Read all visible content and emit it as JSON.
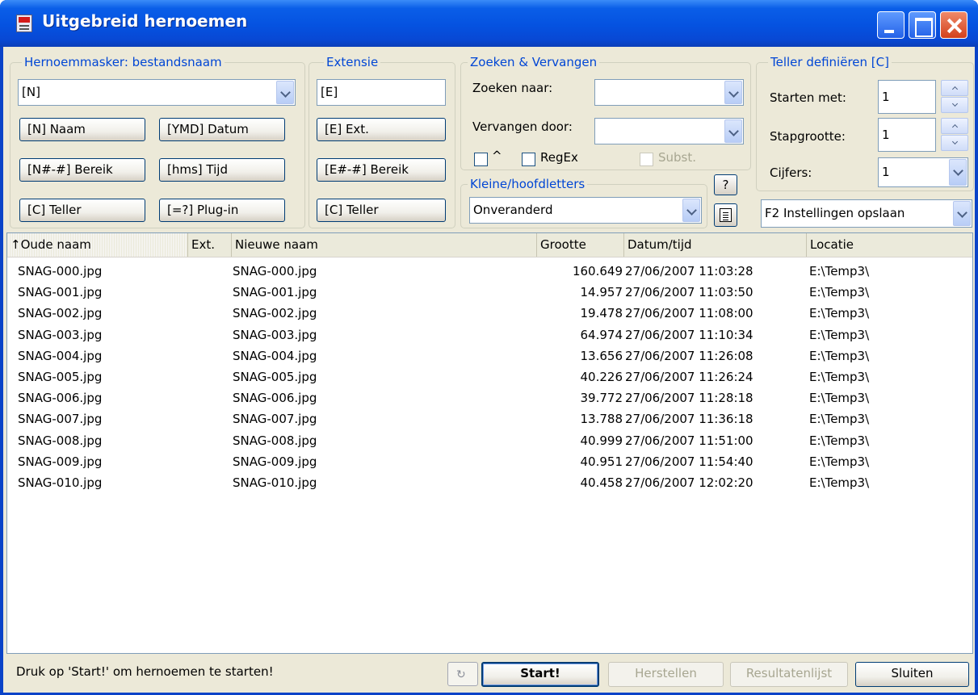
{
  "window": {
    "title": "Uitgebreid hernoemen"
  },
  "mask": {
    "label": "Hernoemmasker: bestandsnaam",
    "value": "[N]",
    "buttons": [
      "[N]  Naam",
      "[YMD]  Datum",
      "[N#-#] Bereik",
      "[hms]  Tijd",
      "[C]  Teller",
      "[=?]  Plug-in"
    ]
  },
  "ext": {
    "label": "Extensie",
    "value": "[E]",
    "buttons": [
      "[E]  Ext.",
      "[E#-#] Bereik",
      "[C]  Teller"
    ]
  },
  "search": {
    "label": "Zoeken & Vervangen",
    "find_label": "Zoeken naar:",
    "find_value": "",
    "replace_label": "Vervangen door:",
    "replace_value": "",
    "caret_label": "^",
    "regex_label": "RegEx",
    "subst_label": "Subst."
  },
  "case": {
    "label": "Kleine/hoofdletters",
    "value": "Onveranderd",
    "help_label": "?"
  },
  "counter": {
    "label": "Teller definiëren [C]",
    "start_label": "Starten met:",
    "start_value": "1",
    "step_label": "Stapgrootte:",
    "step_value": "1",
    "digits_label": "Cijfers:",
    "digits_value": "1"
  },
  "settings": {
    "value": "F2 Instellingen opslaan"
  },
  "list": {
    "columns": {
      "old": "Oude naam",
      "ext": "Ext.",
      "new": "Nieuwe naam",
      "size": "Grootte",
      "date": "Datum/tijd",
      "loc": "Locatie"
    },
    "sort_arrow": "↑",
    "rows": [
      {
        "old": "SNAG-000.jpg",
        "new": "SNAG-000.jpg",
        "size": "160.649",
        "date": "27/06/2007 11:03:28",
        "loc": "E:\\Temp3\\"
      },
      {
        "old": "SNAG-001.jpg",
        "new": "SNAG-001.jpg",
        "size": "14.957",
        "date": "27/06/2007 11:03:50",
        "loc": "E:\\Temp3\\"
      },
      {
        "old": "SNAG-002.jpg",
        "new": "SNAG-002.jpg",
        "size": "19.478",
        "date": "27/06/2007 11:08:00",
        "loc": "E:\\Temp3\\"
      },
      {
        "old": "SNAG-003.jpg",
        "new": "SNAG-003.jpg",
        "size": "64.974",
        "date": "27/06/2007 11:10:34",
        "loc": "E:\\Temp3\\"
      },
      {
        "old": "SNAG-004.jpg",
        "new": "SNAG-004.jpg",
        "size": "13.656",
        "date": "27/06/2007 11:26:08",
        "loc": "E:\\Temp3\\"
      },
      {
        "old": "SNAG-005.jpg",
        "new": "SNAG-005.jpg",
        "size": "40.226",
        "date": "27/06/2007 11:26:24",
        "loc": "E:\\Temp3\\"
      },
      {
        "old": "SNAG-006.jpg",
        "new": "SNAG-006.jpg",
        "size": "39.772",
        "date": "27/06/2007 11:28:18",
        "loc": "E:\\Temp3\\"
      },
      {
        "old": "SNAG-007.jpg",
        "new": "SNAG-007.jpg",
        "size": "13.788",
        "date": "27/06/2007 11:36:18",
        "loc": "E:\\Temp3\\"
      },
      {
        "old": "SNAG-008.jpg",
        "new": "SNAG-008.jpg",
        "size": "40.999",
        "date": "27/06/2007 11:51:00",
        "loc": "E:\\Temp3\\"
      },
      {
        "old": "SNAG-009.jpg",
        "new": "SNAG-009.jpg",
        "size": "40.951",
        "date": "27/06/2007 11:54:40",
        "loc": "E:\\Temp3\\"
      },
      {
        "old": "SNAG-010.jpg",
        "new": "SNAG-010.jpg",
        "size": "40.458",
        "date": "27/06/2007 12:02:20",
        "loc": "E:\\Temp3\\"
      }
    ]
  },
  "footer": {
    "status": "Druk op 'Start!' om hernoemen te starten!",
    "start": "Start!",
    "restore": "Herstellen",
    "results": "Resultatenlijst",
    "close": "Sluiten"
  }
}
